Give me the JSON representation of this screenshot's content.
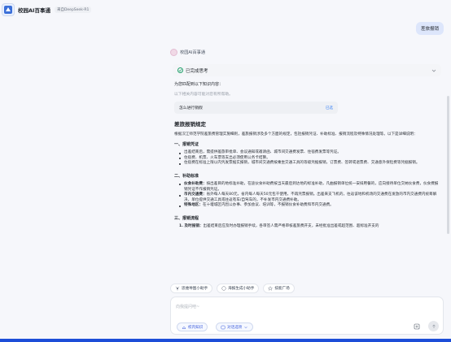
{
  "header": {
    "app_title": "校园AI百事通",
    "model_badge": "来自DeepSeek-R1"
  },
  "user_message": "差旅报销",
  "bot": {
    "name": "校园AI百事通",
    "thinking_label": "已完成思考",
    "found_line": "为您匹配到以下知识内容：",
    "found_note": "以下相关内容可能对您有所帮助。",
    "kb_card": {
      "title": "怎么进行销假",
      "tag": "已选"
    },
    "answer_title": "差旅报销规定",
    "intro": "根据汉江师范学院差旅费管理实施细则，差旅报销涉及多个方面的规定，包括报销凭证、补助标准、报销流程及特殊情况处理等。以下是详细说明：",
    "sections": [
      {
        "title": "一、报销凭证",
        "items": [
          {
            "bold": "",
            "text": "出差结束后，需提供差旅审批单、会议通知或邀请函、城市间交通费发票、住宿费发票等凭证。"
          },
          {
            "bold": "",
            "text": "住宿费、机票、火车票等支出必须使用公务卡结算。"
          },
          {
            "bold": "",
            "text": "住宿费在标准上限以内凭发票据实报销，城市间交通费按乘坐交通工具的等级凭据报销，订票费、签转或退票费、交通意外保险费等凭据报销。"
          }
        ]
      },
      {
        "title": "二、补助标准",
        "items": [
          {
            "bold": "伙食补助费：",
            "text": "按出差目的地标准补助，在途伙食补助费按当天最后到达地的标准补助，凡曲报销单位统一安排用餐的，应向接待单位交纳伙食费，伙食费报销凭证不作报销凭证。"
          },
          {
            "bold": "市内交通费：",
            "text": "省外每人每天80元，省内每人每天50元包干使用，不再凭票报销。出差来支飞机的，往返该地和机场的交通费在发放的市内交通费内统筹解决，单位提供交通工具或往返有车/自驾车的，不补发市内交通费补助。"
          },
          {
            "bold": "特殊地区：",
            "text": "在十堰城区内因公办事、参加会议、培训等，不报销伙食补助费和市内交通费。"
          }
        ]
      },
      {
        "title": "三、报销流程",
        "ordered": [
          {
            "bold": "1. 及时报销：",
            "text": "出差结束后应及时办理报销手续，各审签人需严格审核差旅费开支，未经批准出差或超范围、超标准开支的"
          }
        ]
      }
    ]
  },
  "quick_actions": [
    "思维导图小助手",
    "海报生成小助手",
    "技能广场"
  ],
  "composer": {
    "placeholder": "向我提问吧~",
    "chips": [
      "校内知识",
      "对话选项"
    ]
  },
  "icons": {
    "logo": "campus-logo-icon",
    "check": "check-circle-icon",
    "chevron": "chevron-down-icon",
    "mindmap": "mindmap-icon",
    "poster": "poster-icon",
    "skills": "skills-icon",
    "knowledge": "knowledge-icon",
    "options": "options-icon",
    "attach": "attach-icon",
    "send": "send-arrow-icon"
  },
  "colors": {
    "accent": "#3b82f6",
    "user_bubble": "#dde6fb",
    "success": "#22a06b"
  }
}
